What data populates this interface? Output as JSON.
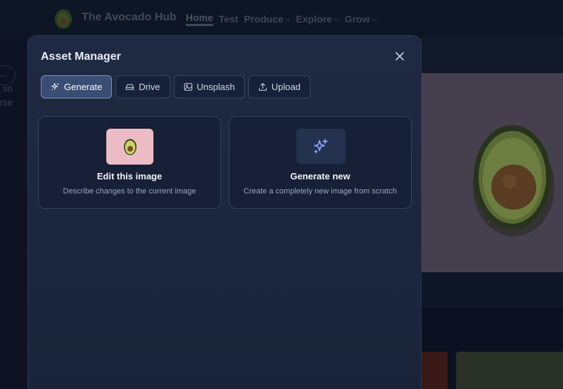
{
  "site": {
    "title": "The Avocado Hub",
    "nav": [
      {
        "label": "Home",
        "dropdown": false
      },
      {
        "label": "Test",
        "dropdown": false
      },
      {
        "label": "Produce",
        "dropdown": true
      },
      {
        "label": "Explore",
        "dropdown": true
      },
      {
        "label": "Grow",
        "dropdown": true
      }
    ],
    "more_label": "···",
    "left_text": [
      "so",
      "rse"
    ]
  },
  "modal": {
    "title": "Asset Manager",
    "tabs": [
      {
        "label": "Generate",
        "icon": "sparkles-icon",
        "active": true
      },
      {
        "label": "Drive",
        "icon": "drive-icon",
        "active": false
      },
      {
        "label": "Unsplash",
        "icon": "image-icon",
        "active": false
      },
      {
        "label": "Upload",
        "icon": "upload-icon",
        "active": false
      }
    ],
    "cards": [
      {
        "title": "Edit this image",
        "description": "Describe changes to the current image",
        "icon": "avocado-thumbnail"
      },
      {
        "title": "Generate new",
        "description": "Create a completely new image from scratch",
        "icon": "sparkles-icon"
      }
    ]
  },
  "colors": {
    "accent": "#3a4d74",
    "accent_border": "#7b93c4",
    "sparkle": "#8aa8ff",
    "modal_bg": "#1f2a42"
  }
}
